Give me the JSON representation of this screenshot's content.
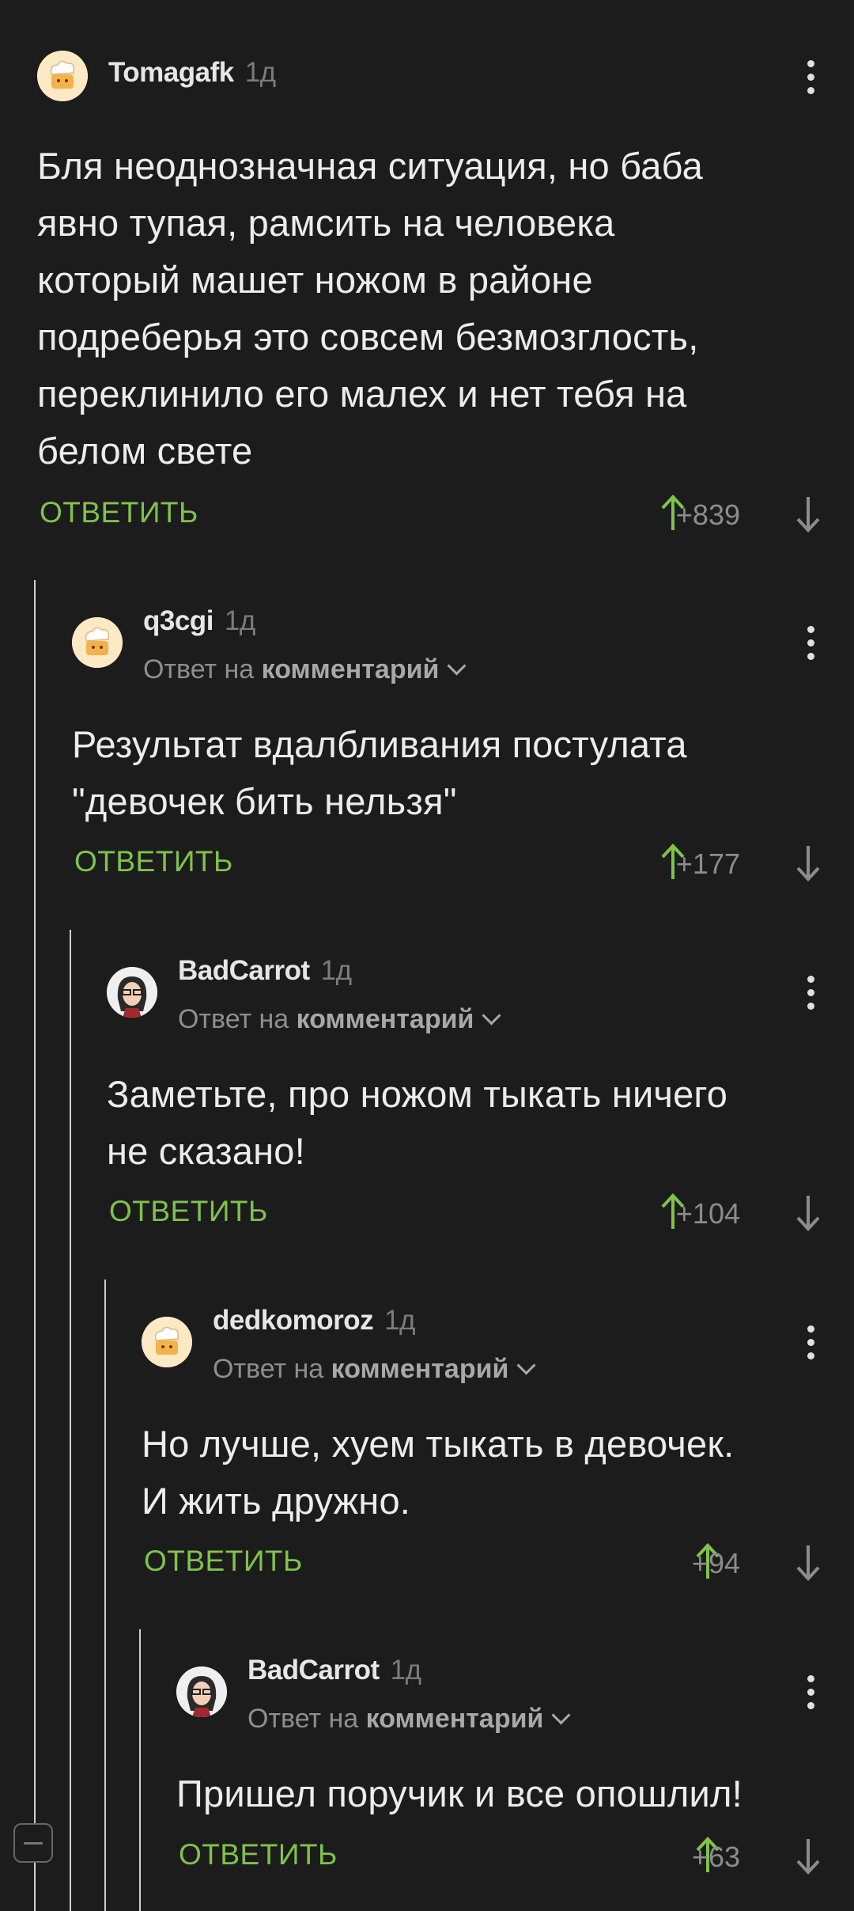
{
  "colors": {
    "background": "#1c1c1d",
    "accent_green": "#7fc34a",
    "text": "#ececec",
    "muted": "#8e8e8e"
  },
  "reply_label": "ОТВЕТИТЬ",
  "reply_prefix": "Ответ на",
  "reply_target": "комментарий",
  "comments": [
    {
      "author": "Tomagafk",
      "time": "1д",
      "avatar": "chef-avatar",
      "text": [
        "Бля неоднозначная ситуация, но баба",
        "явно тупая, рамсить на человека",
        "который машет ножом в районе",
        "подреберья это совсем безмозглость,",
        "переклинило его малех и нет тебя на",
        "белом свете"
      ],
      "score": "+839"
    },
    {
      "author": "q3cgi",
      "time": "1д",
      "avatar": "chef-avatar",
      "text": [
        "Результат вдалбливания постулата",
        "\"девочек бить нельзя\""
      ],
      "score": "+177"
    },
    {
      "author": "BadCarrot",
      "time": "1д",
      "avatar": "face-avatar",
      "text": [
        "Заметьте, про ножом тыкать ничего",
        "не сказано!"
      ],
      "score": "+104"
    },
    {
      "author": "dedkomoroz",
      "time": "1д",
      "avatar": "chef-avatar",
      "text": [
        "Но лучше, хуем тыкать в девочек.",
        "И жить дружно."
      ],
      "score": "+94"
    },
    {
      "author": "BadCarrot",
      "time": "1д",
      "avatar": "face-avatar",
      "text": [
        "Пришел поручик и все опошлил!"
      ],
      "score": "+63"
    }
  ]
}
